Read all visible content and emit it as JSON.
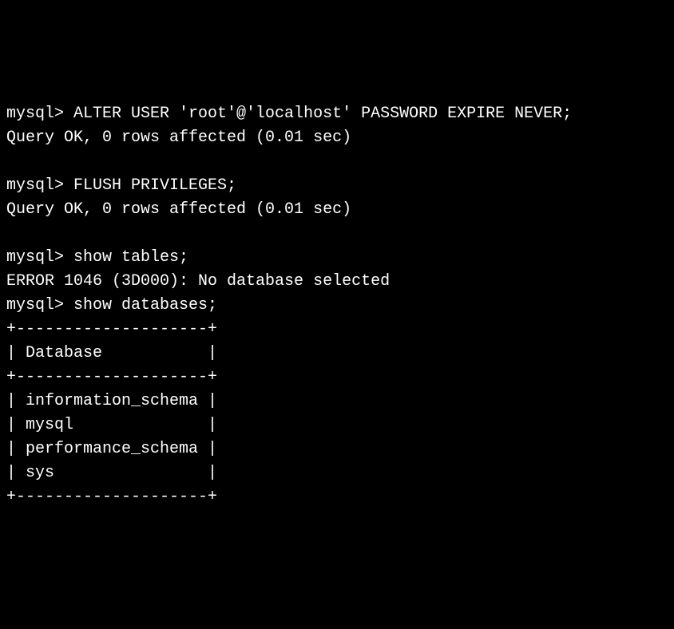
{
  "terminal": {
    "lines": [
      {
        "type": "command",
        "prompt": "mysql> ",
        "text": "ALTER USER 'root'@'localhost' PASSWORD EXPIRE NEVER;"
      },
      {
        "type": "output",
        "text": "Query OK, 0 rows affected (0.01 sec)"
      },
      {
        "type": "blank",
        "text": ""
      },
      {
        "type": "command",
        "prompt": "mysql> ",
        "text": "FLUSH PRIVILEGES;"
      },
      {
        "type": "output",
        "text": "Query OK, 0 rows affected (0.01 sec)"
      },
      {
        "type": "blank",
        "text": ""
      },
      {
        "type": "command",
        "prompt": "mysql> ",
        "text": "show tables;"
      },
      {
        "type": "output",
        "text": "ERROR 1046 (3D000): No database selected"
      },
      {
        "type": "command",
        "prompt": "mysql> ",
        "text": "show databases;"
      },
      {
        "type": "output",
        "text": "+--------------------+"
      },
      {
        "type": "output",
        "text": "| Database           |"
      },
      {
        "type": "output",
        "text": "+--------------------+"
      },
      {
        "type": "output",
        "text": "| information_schema |"
      },
      {
        "type": "output",
        "text": "| mysql              |"
      },
      {
        "type": "output",
        "text": "| performance_schema |"
      },
      {
        "type": "output",
        "text": "| sys                |"
      },
      {
        "type": "output",
        "text": "+--------------------+"
      }
    ]
  }
}
